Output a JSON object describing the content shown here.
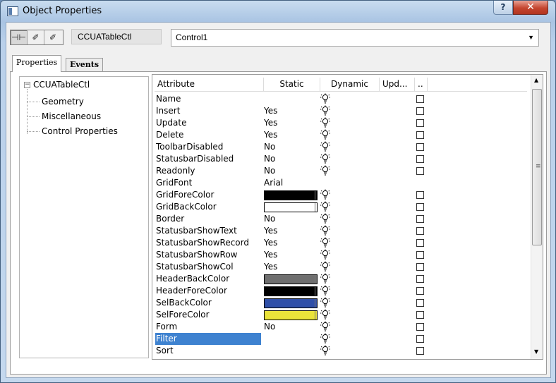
{
  "window": {
    "title": "Object Properties",
    "help_label": "?",
    "close_label": "✕"
  },
  "toolbar": {
    "pin_label": "⊣⊢",
    "brush1_label": "✐",
    "brush2_label": "✐"
  },
  "object_type": "CCUATableCtl",
  "control_name": "Control1",
  "tabs": [
    {
      "label": "Properties"
    },
    {
      "label": "Events"
    }
  ],
  "tree": {
    "root": "CCUATableCtl",
    "children": [
      {
        "label": "Geometry"
      },
      {
        "label": "Miscellaneous"
      },
      {
        "label": "Control Properties"
      }
    ]
  },
  "grid": {
    "columns": [
      "Attribute",
      "Static",
      "Dynamic",
      "Upd...",
      ".."
    ],
    "rows": [
      {
        "attr": "Name",
        "static": "",
        "bulb": true,
        "check": true
      },
      {
        "attr": "Insert",
        "static": "Yes",
        "bulb": true,
        "check": true
      },
      {
        "attr": "Update",
        "static": "Yes",
        "bulb": true,
        "check": true
      },
      {
        "attr": "Delete",
        "static": "Yes",
        "bulb": true,
        "check": true
      },
      {
        "attr": "ToolbarDisabled",
        "static": "No",
        "bulb": true,
        "check": true
      },
      {
        "attr": "StatusbarDisabled",
        "static": "No",
        "bulb": true,
        "check": true
      },
      {
        "attr": "Readonly",
        "static": "No",
        "bulb": true,
        "check": true
      },
      {
        "attr": "GridFont",
        "static": "Arial",
        "bulb": false,
        "check": false
      },
      {
        "attr": "GridForeColor",
        "static": "",
        "color": "#000000",
        "bulb": true,
        "check": true
      },
      {
        "attr": "GridBackColor",
        "static": "",
        "color": "#ffffff",
        "bulb": true,
        "check": true
      },
      {
        "attr": "Border",
        "static": "No",
        "bulb": true,
        "check": true
      },
      {
        "attr": "StatusbarShowText",
        "static": "Yes",
        "bulb": true,
        "check": true
      },
      {
        "attr": "StatusbarShowRecord",
        "static": "Yes",
        "bulb": true,
        "check": true
      },
      {
        "attr": "StatusbarShowRow",
        "static": "Yes",
        "bulb": true,
        "check": true
      },
      {
        "attr": "StatusbarShowCol",
        "static": "Yes",
        "bulb": true,
        "check": true
      },
      {
        "attr": "HeaderBackColor",
        "static": "",
        "color": "#6f6f6f",
        "bulb": true,
        "check": true
      },
      {
        "attr": "HeaderForeColor",
        "static": "",
        "color": "#000000",
        "bulb": true,
        "check": true
      },
      {
        "attr": "SelBackColor",
        "static": "",
        "color": "#2f4fa8",
        "bulb": true,
        "check": true
      },
      {
        "attr": "SelForeColor",
        "static": "",
        "color": "#eae33a",
        "bulb": true,
        "check": true
      },
      {
        "attr": "Form",
        "static": "No",
        "bulb": true,
        "check": true
      },
      {
        "attr": "Filter",
        "static": "",
        "bulb": true,
        "check": true,
        "selected": true
      },
      {
        "attr": "Sort",
        "static": "",
        "bulb": true,
        "check": true
      }
    ]
  },
  "icons": {
    "bulb": "lightbulb-icon",
    "scroll_up": "▲",
    "scroll_down": "▼",
    "grip": "≡",
    "dropdown": "▼"
  },
  "colors": {
    "selection": "#3e82d0"
  }
}
